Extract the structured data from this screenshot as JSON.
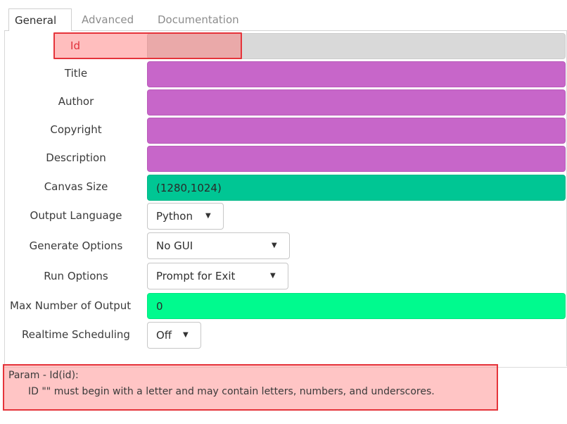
{
  "tabs": [
    {
      "label": "General",
      "active": true
    },
    {
      "label": "Advanced",
      "active": false
    },
    {
      "label": "Documentation",
      "active": false
    }
  ],
  "form": {
    "id": {
      "label": "Id",
      "value": "",
      "color": "#d9d9d9",
      "error_color": "#e5343b"
    },
    "title": {
      "label": "Title",
      "value": "",
      "color": "#c766c9"
    },
    "author": {
      "label": "Author",
      "value": "",
      "color": "#c766c9"
    },
    "copyright": {
      "label": "Copyright",
      "value": "",
      "color": "#c766c9"
    },
    "description": {
      "label": "Description",
      "value": "",
      "color": "#c766c9"
    },
    "canvas_size": {
      "label": "Canvas Size",
      "value": "(1280,1024)",
      "color": "#00c694"
    },
    "output_language": {
      "label": "Output Language",
      "value": "Python"
    },
    "generate_options": {
      "label": "Generate Options",
      "value": "No GUI"
    },
    "run_options": {
      "label": "Run Options",
      "value": "Prompt for Exit"
    },
    "max_output": {
      "label": "Max Number of Output",
      "value": "0",
      "color": "#00fa8e"
    },
    "realtime_scheduling": {
      "label": "Realtime Scheduling",
      "value": "Off"
    }
  },
  "message": {
    "title": "Param - Id(id):",
    "text": "ID \"\" must begin with a letter and may contain letters, numbers, and underscores."
  },
  "icons": {
    "dropdown": "caret-down-icon"
  }
}
